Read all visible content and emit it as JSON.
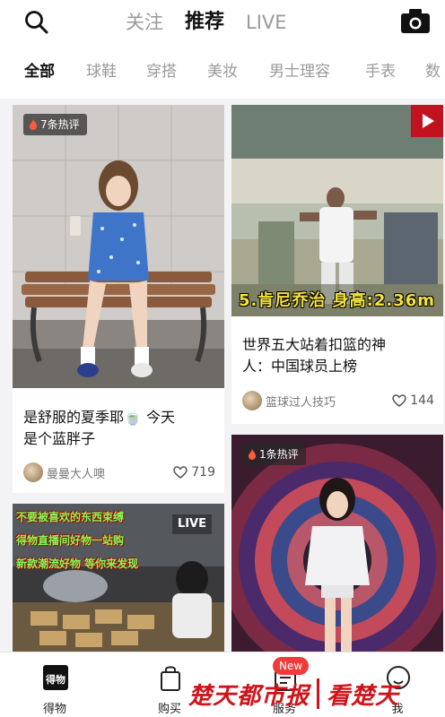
{
  "header": {
    "tabs": [
      {
        "label": "关注",
        "active": false
      },
      {
        "label": "推荐",
        "active": true
      },
      {
        "label": "LIVE",
        "active": false
      }
    ],
    "icons": {
      "search": "search-icon",
      "camera": "camera-icon"
    }
  },
  "categories": [
    {
      "label": "全部",
      "active": true
    },
    {
      "label": "球鞋",
      "active": false
    },
    {
      "label": "穿搭",
      "active": false
    },
    {
      "label": "美妆",
      "active": false
    },
    {
      "label": "男士理容",
      "active": false
    },
    {
      "label": "手表",
      "active": false
    },
    {
      "label": "数",
      "active": false
    }
  ],
  "feed": [
    {
      "badge": "7条热评",
      "title_line1": "是舒服的夏季耶🍵 今天",
      "title_line2": "是个蓝胖子",
      "author": "曼曼大人噢",
      "likes": "719"
    },
    {
      "video_caption": "5.肯尼乔治 身高:2.36m",
      "title_line1": "世界五大站着扣篮的神",
      "title_line2": "人：中国球员上榜",
      "author": "篮球过人技巧",
      "likes": "144"
    },
    {
      "live_badge": "LIVE",
      "overlay_line1": "不要被喜欢的东西束缚",
      "overlay_line2": "得物直播间好物一站购",
      "overlay_line3": "新款潮流好物 等你来发现"
    },
    {
      "badge": "1条热评"
    }
  ],
  "bottom_nav": [
    {
      "label": "得物",
      "icon": "dewu-logo-icon"
    },
    {
      "label": "购买",
      "icon": "shopping-bag-icon"
    },
    {
      "label": "服务",
      "icon": "service-icon",
      "badge": "New"
    },
    {
      "label": "我",
      "icon": "profile-icon"
    }
  ],
  "watermark": {
    "left": "楚天都市报",
    "right": "看楚天"
  },
  "colors": {
    "accent": "#c1121f",
    "watermark": "#d11218",
    "badge_new": "#ef3b3b"
  }
}
